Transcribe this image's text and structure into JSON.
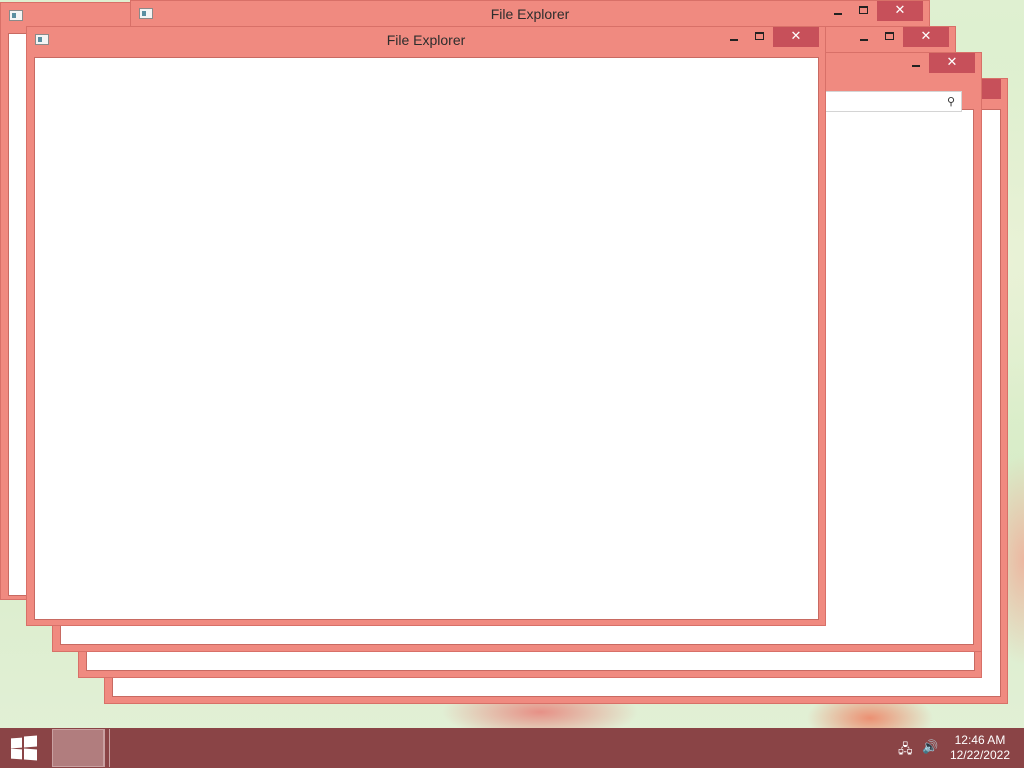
{
  "windows": [
    {
      "title": "File Explorer"
    },
    {
      "title": "File Explorer"
    }
  ],
  "window_controls": {
    "minimize": "–",
    "maximize": "□",
    "close": "✕"
  },
  "search": {
    "icon": "search-icon"
  },
  "taskbar": {
    "start_icon": "windows-logo-icon",
    "tray": {
      "network_icon": "network-icon",
      "volume_icon": "volume-icon"
    },
    "clock": {
      "time": "12:46 AM",
      "date": "12/22/2022"
    }
  },
  "colors": {
    "window_frame": "#f08a80",
    "close_button": "#c7505a",
    "taskbar": "#8a4446"
  }
}
